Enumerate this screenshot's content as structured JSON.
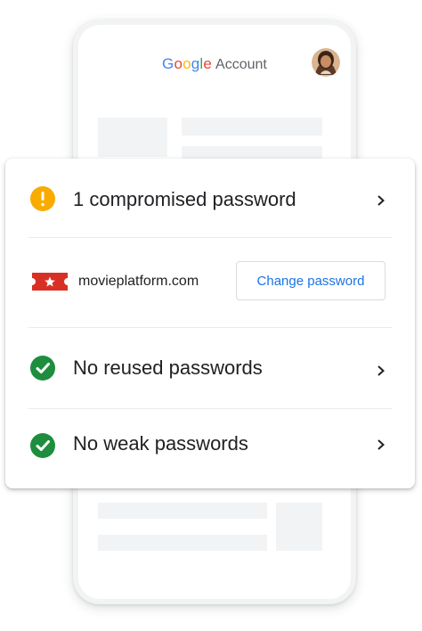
{
  "header": {
    "brand_g": "G",
    "brand_o1": "o",
    "brand_o2": "o",
    "brand_g2": "g",
    "brand_l": "l",
    "brand_e": "e",
    "account_label": "Account",
    "avatar_icon": "user-avatar"
  },
  "colors": {
    "google_blue": "#4285F4",
    "google_red": "#EA4335",
    "google_yellow": "#FBBC05",
    "google_green": "#34A853",
    "warning": "#F9AB00",
    "ok": "#1E8E3E",
    "link": "#1a73e8"
  },
  "checkup": {
    "compromised": {
      "label": "1 compromised password",
      "icon": "warning-icon"
    },
    "site": {
      "name": "movieplatform.com",
      "icon": "ticket-star-icon",
      "action_label": "Change password"
    },
    "reused": {
      "label": "No reused passwords",
      "icon": "check-circle-icon"
    },
    "weak": {
      "label": "No weak passwords",
      "icon": "check-circle-icon"
    }
  }
}
